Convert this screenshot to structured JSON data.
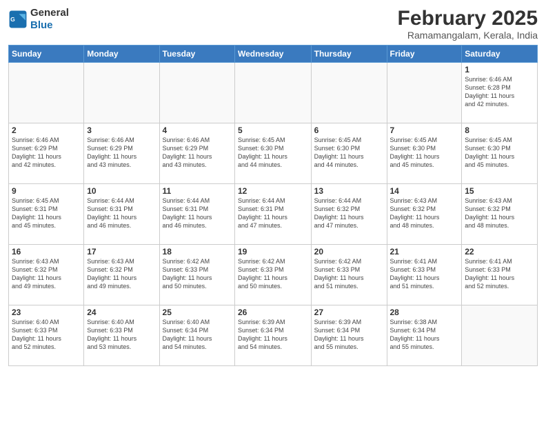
{
  "header": {
    "logo_line1": "General",
    "logo_line2": "Blue",
    "title": "February 2025",
    "subtitle": "Ramamangalam, Kerala, India"
  },
  "weekdays": [
    "Sunday",
    "Monday",
    "Tuesday",
    "Wednesday",
    "Thursday",
    "Friday",
    "Saturday"
  ],
  "weeks": [
    [
      {
        "day": "",
        "info": ""
      },
      {
        "day": "",
        "info": ""
      },
      {
        "day": "",
        "info": ""
      },
      {
        "day": "",
        "info": ""
      },
      {
        "day": "",
        "info": ""
      },
      {
        "day": "",
        "info": ""
      },
      {
        "day": "1",
        "info": "Sunrise: 6:46 AM\nSunset: 6:28 PM\nDaylight: 11 hours\nand 42 minutes."
      }
    ],
    [
      {
        "day": "2",
        "info": "Sunrise: 6:46 AM\nSunset: 6:29 PM\nDaylight: 11 hours\nand 42 minutes."
      },
      {
        "day": "3",
        "info": "Sunrise: 6:46 AM\nSunset: 6:29 PM\nDaylight: 11 hours\nand 43 minutes."
      },
      {
        "day": "4",
        "info": "Sunrise: 6:46 AM\nSunset: 6:29 PM\nDaylight: 11 hours\nand 43 minutes."
      },
      {
        "day": "5",
        "info": "Sunrise: 6:45 AM\nSunset: 6:30 PM\nDaylight: 11 hours\nand 44 minutes."
      },
      {
        "day": "6",
        "info": "Sunrise: 6:45 AM\nSunset: 6:30 PM\nDaylight: 11 hours\nand 44 minutes."
      },
      {
        "day": "7",
        "info": "Sunrise: 6:45 AM\nSunset: 6:30 PM\nDaylight: 11 hours\nand 45 minutes."
      },
      {
        "day": "8",
        "info": "Sunrise: 6:45 AM\nSunset: 6:30 PM\nDaylight: 11 hours\nand 45 minutes."
      }
    ],
    [
      {
        "day": "9",
        "info": "Sunrise: 6:45 AM\nSunset: 6:31 PM\nDaylight: 11 hours\nand 45 minutes."
      },
      {
        "day": "10",
        "info": "Sunrise: 6:44 AM\nSunset: 6:31 PM\nDaylight: 11 hours\nand 46 minutes."
      },
      {
        "day": "11",
        "info": "Sunrise: 6:44 AM\nSunset: 6:31 PM\nDaylight: 11 hours\nand 46 minutes."
      },
      {
        "day": "12",
        "info": "Sunrise: 6:44 AM\nSunset: 6:31 PM\nDaylight: 11 hours\nand 47 minutes."
      },
      {
        "day": "13",
        "info": "Sunrise: 6:44 AM\nSunset: 6:32 PM\nDaylight: 11 hours\nand 47 minutes."
      },
      {
        "day": "14",
        "info": "Sunrise: 6:43 AM\nSunset: 6:32 PM\nDaylight: 11 hours\nand 48 minutes."
      },
      {
        "day": "15",
        "info": "Sunrise: 6:43 AM\nSunset: 6:32 PM\nDaylight: 11 hours\nand 48 minutes."
      }
    ],
    [
      {
        "day": "16",
        "info": "Sunrise: 6:43 AM\nSunset: 6:32 PM\nDaylight: 11 hours\nand 49 minutes."
      },
      {
        "day": "17",
        "info": "Sunrise: 6:43 AM\nSunset: 6:32 PM\nDaylight: 11 hours\nand 49 minutes."
      },
      {
        "day": "18",
        "info": "Sunrise: 6:42 AM\nSunset: 6:33 PM\nDaylight: 11 hours\nand 50 minutes."
      },
      {
        "day": "19",
        "info": "Sunrise: 6:42 AM\nSunset: 6:33 PM\nDaylight: 11 hours\nand 50 minutes."
      },
      {
        "day": "20",
        "info": "Sunrise: 6:42 AM\nSunset: 6:33 PM\nDaylight: 11 hours\nand 51 minutes."
      },
      {
        "day": "21",
        "info": "Sunrise: 6:41 AM\nSunset: 6:33 PM\nDaylight: 11 hours\nand 51 minutes."
      },
      {
        "day": "22",
        "info": "Sunrise: 6:41 AM\nSunset: 6:33 PM\nDaylight: 11 hours\nand 52 minutes."
      }
    ],
    [
      {
        "day": "23",
        "info": "Sunrise: 6:40 AM\nSunset: 6:33 PM\nDaylight: 11 hours\nand 52 minutes."
      },
      {
        "day": "24",
        "info": "Sunrise: 6:40 AM\nSunset: 6:33 PM\nDaylight: 11 hours\nand 53 minutes."
      },
      {
        "day": "25",
        "info": "Sunrise: 6:40 AM\nSunset: 6:34 PM\nDaylight: 11 hours\nand 54 minutes."
      },
      {
        "day": "26",
        "info": "Sunrise: 6:39 AM\nSunset: 6:34 PM\nDaylight: 11 hours\nand 54 minutes."
      },
      {
        "day": "27",
        "info": "Sunrise: 6:39 AM\nSunset: 6:34 PM\nDaylight: 11 hours\nand 55 minutes."
      },
      {
        "day": "28",
        "info": "Sunrise: 6:38 AM\nSunset: 6:34 PM\nDaylight: 11 hours\nand 55 minutes."
      },
      {
        "day": "",
        "info": ""
      }
    ]
  ]
}
